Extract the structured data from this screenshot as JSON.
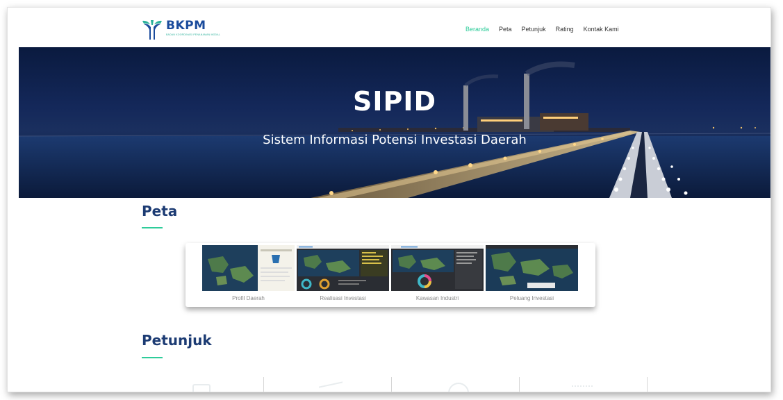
{
  "brand": {
    "name": "BKPM",
    "subtitle": "BADAN KOORDINASI PENANAMAN MODAL",
    "color": "#1a4b9c",
    "accent": "#2bb19a"
  },
  "nav": {
    "items": [
      {
        "label": "Beranda",
        "active": true
      },
      {
        "label": "Peta",
        "active": false
      },
      {
        "label": "Petunjuk",
        "active": false
      },
      {
        "label": "Rating",
        "active": false
      },
      {
        "label": "Kontak Kami",
        "active": false
      }
    ],
    "active_color": "#2ecc9a"
  },
  "hero": {
    "title": "SIPID",
    "subtitle": "Sistem Informasi Potensi Investasi Daerah"
  },
  "peta": {
    "title": "Peta",
    "cards": [
      {
        "label": "Profil Daerah",
        "icon": "map-thumbnail"
      },
      {
        "label": "Realisasi Investasi",
        "icon": "dashboard-thumbnail"
      },
      {
        "label": "Kawasan Industri",
        "icon": "dashboard-thumbnail"
      },
      {
        "label": "Peluang Investasi",
        "icon": "map-thumbnail"
      }
    ]
  },
  "petunjuk": {
    "title": "Petunjuk"
  }
}
